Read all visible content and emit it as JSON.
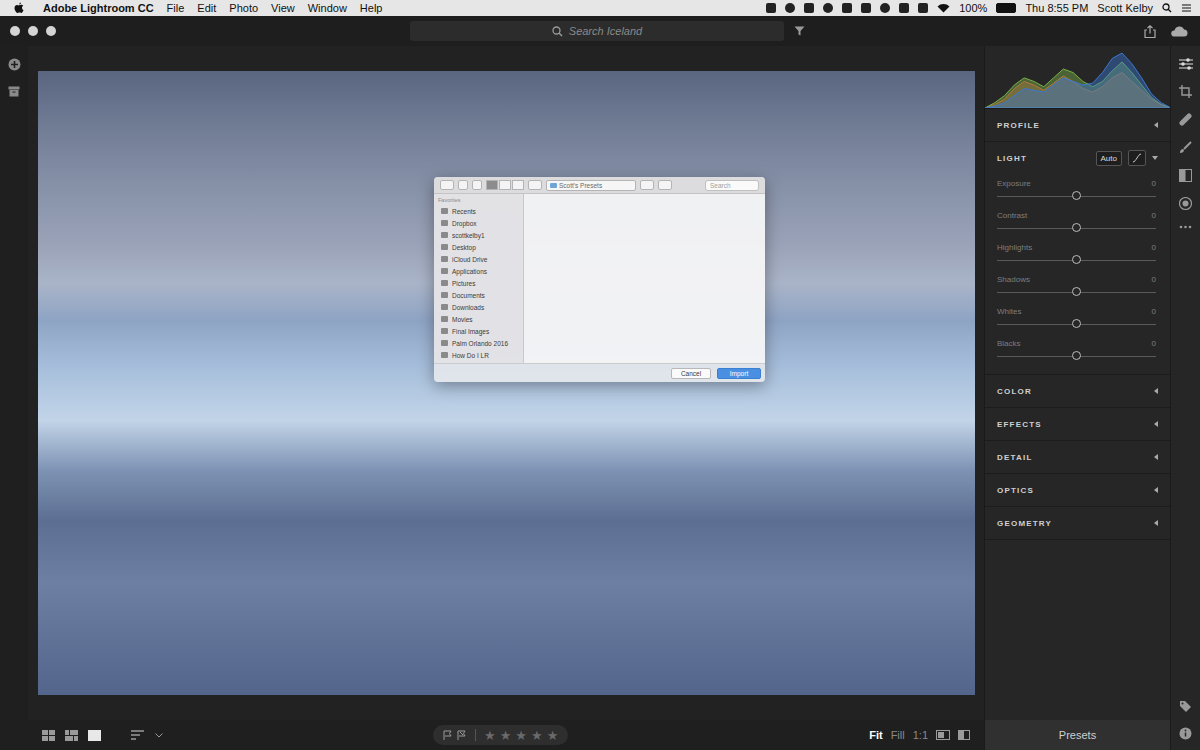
{
  "menubar": {
    "app": "Adobe Lightroom CC",
    "items": [
      "File",
      "Edit",
      "Photo",
      "View",
      "Window",
      "Help"
    ],
    "battery": "100%",
    "clock": "Thu 8:55 PM",
    "user": "Scott Kelby"
  },
  "titlebar": {
    "search_placeholder": "Search Iceland"
  },
  "dialog": {
    "path": "Scott's Presets",
    "search_placeholder": "Search",
    "sidebar_heading": "Favorites",
    "sidebar_items": [
      "Recents",
      "Dropbox",
      "scottkelby1",
      "Desktop",
      "iCloud Drive",
      "Applications",
      "Pictures",
      "Documents",
      "Downloads",
      "Movies",
      "Final Images",
      "Palm Orlando 2016",
      "How Do I LR"
    ],
    "buttons": [
      {
        "label": "Cancel",
        "primary": false
      },
      {
        "label": "Import",
        "primary": true
      }
    ]
  },
  "histogram": {
    "series": [
      {
        "name": "red",
        "color": "#d0503c",
        "values": [
          0,
          4,
          10,
          22,
          30,
          26,
          20,
          28,
          36,
          30,
          22,
          18,
          24,
          34,
          40,
          30,
          20,
          10,
          4,
          0
        ]
      },
      {
        "name": "green",
        "color": "#7ab04a",
        "values": [
          0,
          6,
          14,
          26,
          34,
          30,
          24,
          34,
          44,
          40,
          30,
          24,
          30,
          42,
          52,
          40,
          26,
          12,
          4,
          0
        ]
      },
      {
        "name": "blue",
        "color": "#3c78d0",
        "values": [
          0,
          2,
          6,
          14,
          22,
          20,
          18,
          26,
          34,
          30,
          26,
          28,
          40,
          56,
          62,
          50,
          34,
          16,
          6,
          0
        ]
      }
    ]
  },
  "edit_panel": {
    "sections": [
      {
        "title": "PROFILE",
        "expanded": false
      },
      {
        "title": "LIGHT",
        "expanded": true,
        "auto": "Auto",
        "sliders": [
          {
            "name": "Exposure",
            "reading": "0",
            "level": 0.5
          },
          {
            "name": "Contrast",
            "reading": "0",
            "level": 0.5
          },
          {
            "name": "Highlights",
            "reading": "0",
            "level": 0.5
          },
          {
            "name": "Shadows",
            "reading": "0",
            "level": 0.5
          },
          {
            "name": "Whites",
            "reading": "0",
            "level": 0.5
          },
          {
            "name": "Blacks",
            "reading": "0",
            "level": 0.5
          }
        ]
      },
      {
        "title": "COLOR",
        "expanded": false
      },
      {
        "title": "EFFECTS",
        "expanded": false
      },
      {
        "title": "DETAIL",
        "expanded": false
      },
      {
        "title": "OPTICS",
        "expanded": false
      },
      {
        "title": "GEOMETRY",
        "expanded": false
      }
    ],
    "presets": "Presets"
  },
  "bottom_bar": {
    "rating": {
      "stars": 0,
      "max": 5,
      "glyph": "★"
    },
    "zoom": [
      {
        "label": "Fit",
        "selected": true
      },
      {
        "label": "Fill",
        "selected": false
      },
      {
        "label": "1:1",
        "selected": false
      }
    ]
  }
}
